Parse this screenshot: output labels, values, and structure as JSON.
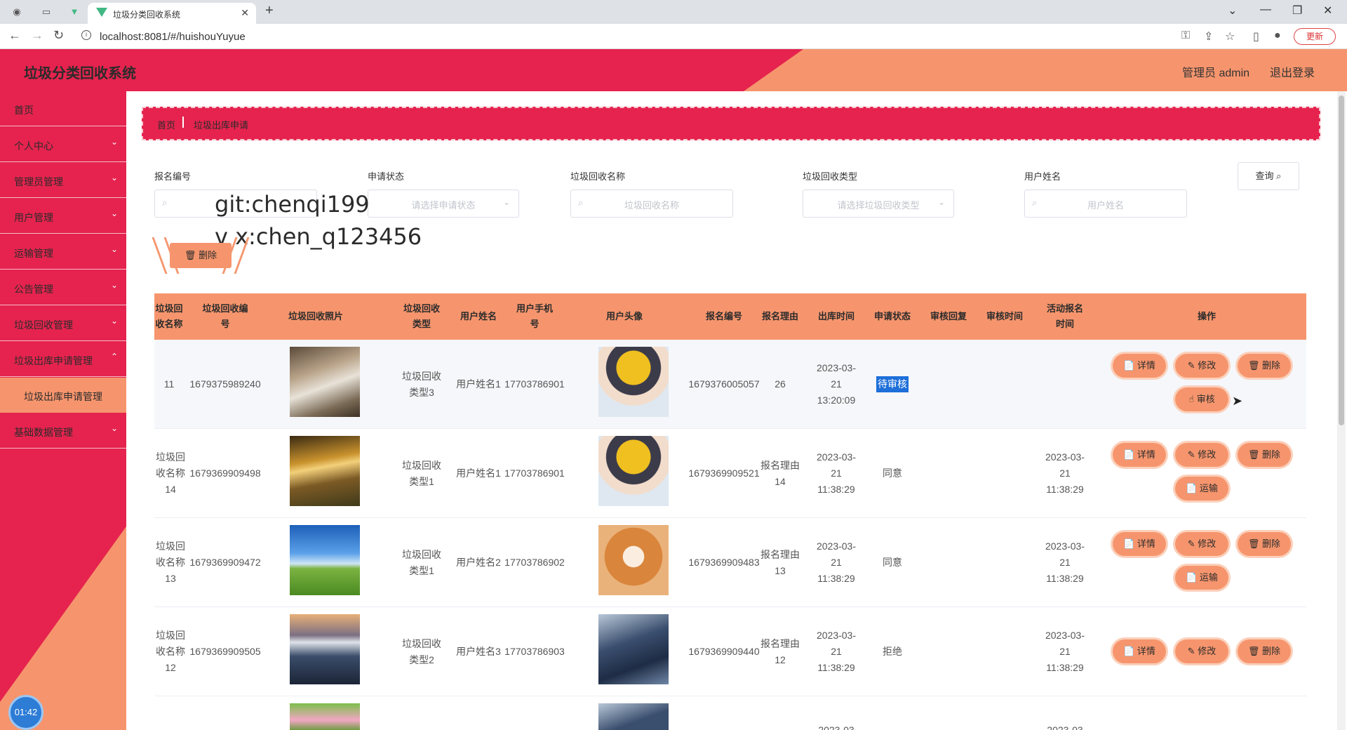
{
  "browser": {
    "tab_title": "垃圾分类回收系统",
    "url": "localhost:8081/#/huishouYuyue",
    "update_label": "更新"
  },
  "header": {
    "brand": "垃圾分类回收系统",
    "admin": "管理员 admin",
    "logout": "退出登录"
  },
  "sidebar": {
    "items": [
      {
        "label": "首页"
      },
      {
        "label": "个人中心"
      },
      {
        "label": "管理员管理"
      },
      {
        "label": "用户管理"
      },
      {
        "label": "运输管理"
      },
      {
        "label": "公告管理"
      },
      {
        "label": "垃圾回收管理"
      },
      {
        "label": "垃圾出库申请管理"
      },
      {
        "label": "基础数据管理"
      }
    ],
    "active_sub": "垃圾出库申请管理",
    "timer": "01:42"
  },
  "breadcrumb": {
    "home": "首页",
    "current": "垃圾出库申请"
  },
  "filters": {
    "signup_no": {
      "label": "报名编号",
      "placeholder": ""
    },
    "status": {
      "label": "申请状态",
      "placeholder": "请选择申请状态"
    },
    "name": {
      "label": "垃圾回收名称",
      "placeholder": "垃圾回收名称"
    },
    "type": {
      "label": "垃圾回收类型",
      "placeholder": "请选择垃圾回收类型"
    },
    "user": {
      "label": "用户姓名",
      "placeholder": "用户姓名"
    },
    "query_label": "查询"
  },
  "watermark": {
    "line1": "git:chenqi199",
    "line2": "v x:chen_q123456"
  },
  "bulk_delete": "删除",
  "table": {
    "headers": [
      "垃圾回收名称",
      "垃圾回收编号",
      "垃圾回收照片",
      "垃圾回收类型",
      "用户姓名",
      "用户手机号",
      "用户头像",
      "报名编号",
      "报名理由",
      "出库时间",
      "申请状态",
      "审核回复",
      "审核时间",
      "活动报名时间",
      "操作"
    ],
    "rows": [
      {
        "name": "11",
        "code": "1679375989240",
        "type": "垃圾回收类型3",
        "user": "用户姓名1",
        "phone": "17703786901",
        "signup": "1679376005057",
        "reason": "26",
        "out_time": "2023-03-21 13:20:09",
        "status": "待审核",
        "reply": "",
        "audit_time": "",
        "act_time": "",
        "actions": [
          "详情",
          "修改",
          "删除",
          "审核"
        ]
      },
      {
        "name": "垃圾回收名称14",
        "code": "1679369909498",
        "type": "垃圾回收类型1",
        "user": "用户姓名1",
        "phone": "17703786901",
        "signup": "1679369909521",
        "reason": "报名理由14",
        "out_time": "2023-03-21 11:38:29",
        "status": "同意",
        "reply": "",
        "audit_time": "",
        "act_time": "2023-03-21 11:38:29",
        "actions": [
          "详情",
          "修改",
          "删除",
          "运输"
        ]
      },
      {
        "name": "垃圾回收名称13",
        "code": "1679369909472",
        "type": "垃圾回收类型1",
        "user": "用户姓名2",
        "phone": "17703786902",
        "signup": "1679369909483",
        "reason": "报名理由13",
        "out_time": "2023-03-21 11:38:29",
        "status": "同意",
        "reply": "",
        "audit_time": "",
        "act_time": "2023-03-21 11:38:29",
        "actions": [
          "详情",
          "修改",
          "删除",
          "运输"
        ]
      },
      {
        "name": "垃圾回收名称12",
        "code": "1679369909505",
        "type": "垃圾回收类型2",
        "user": "用户姓名3",
        "phone": "17703786903",
        "signup": "1679369909440",
        "reason": "报名理由12",
        "out_time": "2023-03-21 11:38:29",
        "status": "拒绝",
        "reply": "",
        "audit_time": "",
        "act_time": "2023-03-21 11:38:29",
        "actions": [
          "详情",
          "修改",
          "删除"
        ]
      },
      {
        "name": "",
        "code": "",
        "type": "",
        "user": "",
        "phone": "",
        "signup": "",
        "reason": "",
        "out_time": "2023-03",
        "status": "",
        "reply": "",
        "audit_time": "",
        "act_time": "2023-03",
        "actions": []
      }
    ]
  },
  "colors": {
    "red": "#e5234e",
    "orange": "#f6956d"
  }
}
